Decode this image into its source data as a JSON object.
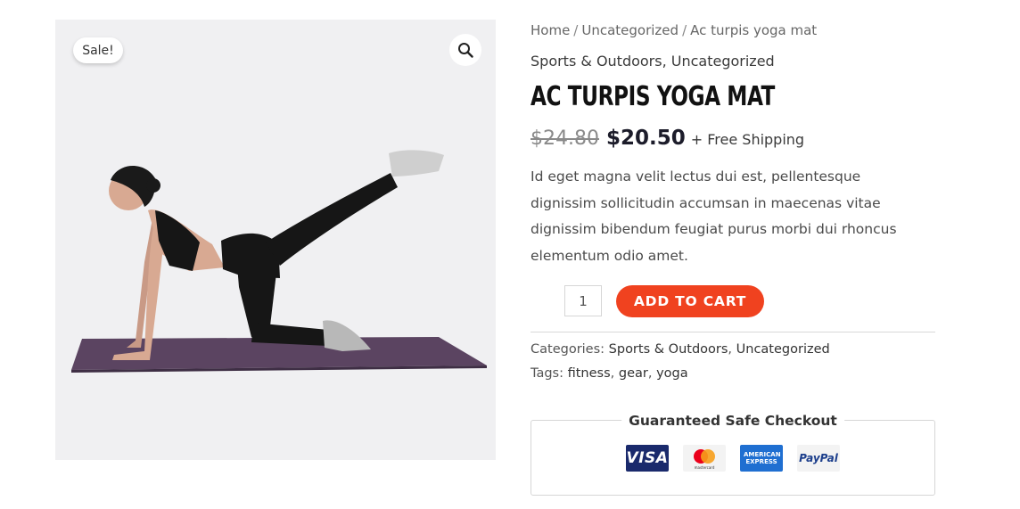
{
  "gallery": {
    "sale_badge": "Sale!",
    "zoom_icon": "magnifier-icon",
    "image_subject": "woman-doing-yoga-on-purple-mat"
  },
  "breadcrumb": {
    "home": "Home",
    "category": "Uncategorized",
    "current": "Ac turpis yoga mat",
    "separator": "/"
  },
  "product": {
    "categories_top": [
      "Sports & Outdoors",
      "Uncategorized"
    ],
    "title": "AC TURPIS YOGA MAT",
    "price_old": "$24.80",
    "price_new": "$20.50",
    "shipping": "+ Free Shipping",
    "description": "Id eget magna velit lectus dui est, pellentesque dignissim sollicitudin accumsan in maecenas vitae dignissim bibendum feugiat purus morbi dui rhoncus elementum odio amet.",
    "quantity": "1",
    "add_to_cart_label": "ADD TO CART"
  },
  "meta": {
    "categories_label": "Categories:",
    "categories": [
      "Sports & Outdoors",
      "Uncategorized"
    ],
    "tags_label": "Tags:",
    "tags": [
      "fitness",
      "gear",
      "yoga"
    ]
  },
  "checkout": {
    "title": "Guaranteed Safe Checkout",
    "cards": [
      {
        "name": "VISA",
        "icon": "visa-card-icon"
      },
      {
        "name": "mastercard",
        "icon": "mastercard-icon"
      },
      {
        "name": "AMERICAN EXPRESS",
        "icon": "amex-card-icon"
      },
      {
        "name": "PayPal",
        "icon": "paypal-icon"
      }
    ]
  },
  "colors": {
    "accent": "#f0421f",
    "gallery_bg": "#f0f0f2",
    "mat": "#5b4461",
    "visa": "#1a2a6c",
    "amex": "#1f6fd1"
  }
}
